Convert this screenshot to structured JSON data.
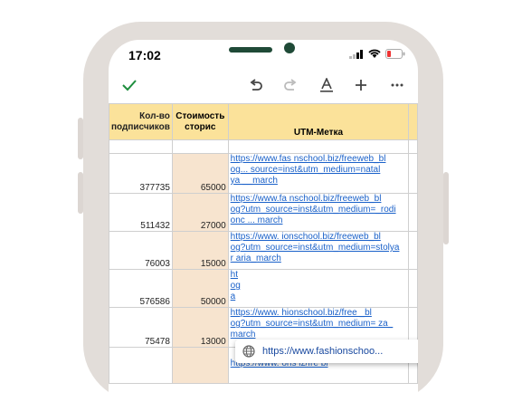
{
  "status_bar": {
    "time": "17:02"
  },
  "toolbar": {
    "icons": [
      "check-icon",
      "undo-icon",
      "redo-icon",
      "text-format-icon",
      "add-icon",
      "more-icon"
    ],
    "accent": "#1e8e3e"
  },
  "table": {
    "headers": {
      "subscribers": "Кол-во подписчиков",
      "cost": "Стоимость сторис",
      "utm": "UTM-Метка"
    },
    "rows": [
      {
        "subscribers": "377735",
        "cost": "65000",
        "utm": [
          "https://www.fas nschool.biz/freeweb_bl",
          "og... source=inst&utm_medium=natal",
          "ya __march"
        ]
      },
      {
        "subscribers": "511432",
        "cost": "27000",
        "utm": [
          "https://www.fa nschool.biz/freeweb_bl",
          "og?utm_source=inst&utm_medium=_rodi",
          "onc ... march"
        ]
      },
      {
        "subscribers": "76003",
        "cost": "15000",
        "utm": [
          "https://www. ionschool.biz/freeweb_bl",
          "og?utm_source=inst&utm_medium=stolya",
          "r aria_march"
        ]
      },
      {
        "subscribers": "576586",
        "cost": "50000",
        "utm": [
          "ht",
          "og",
          "a"
        ]
      },
      {
        "subscribers": "75478",
        "cost": "13000",
        "utm": [
          "https://www. hionschool.biz/free _bl",
          "og?utm_source=inst&utm_medium= za_",
          " march"
        ]
      },
      {
        "subscribers": "",
        "cost": "",
        "utm": [
          "https://www. ons iz/fre bl"
        ]
      }
    ]
  },
  "link_popup": {
    "url": "https://www.fashionschoo..."
  }
}
